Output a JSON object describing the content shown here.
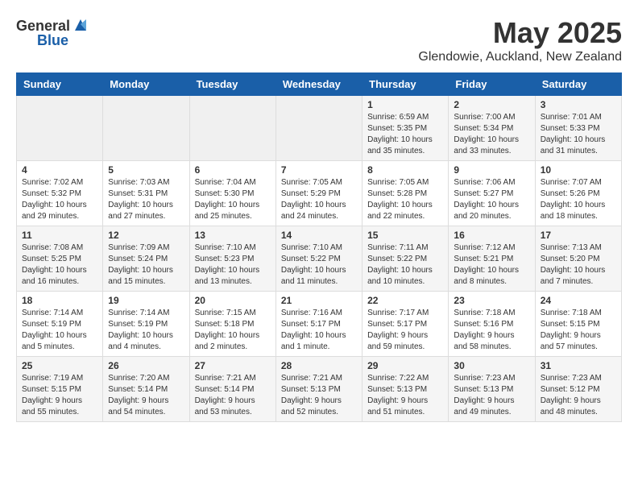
{
  "header": {
    "logo": {
      "general": "General",
      "blue": "Blue"
    },
    "title": "May 2025",
    "location": "Glendowie, Auckland, New Zealand"
  },
  "weekdays": [
    "Sunday",
    "Monday",
    "Tuesday",
    "Wednesday",
    "Thursday",
    "Friday",
    "Saturday"
  ],
  "weeks": [
    [
      {
        "day": "",
        "info": ""
      },
      {
        "day": "",
        "info": ""
      },
      {
        "day": "",
        "info": ""
      },
      {
        "day": "",
        "info": ""
      },
      {
        "day": "1",
        "info": "Sunrise: 6:59 AM\nSunset: 5:35 PM\nDaylight: 10 hours\nand 35 minutes."
      },
      {
        "day": "2",
        "info": "Sunrise: 7:00 AM\nSunset: 5:34 PM\nDaylight: 10 hours\nand 33 minutes."
      },
      {
        "day": "3",
        "info": "Sunrise: 7:01 AM\nSunset: 5:33 PM\nDaylight: 10 hours\nand 31 minutes."
      }
    ],
    [
      {
        "day": "4",
        "info": "Sunrise: 7:02 AM\nSunset: 5:32 PM\nDaylight: 10 hours\nand 29 minutes."
      },
      {
        "day": "5",
        "info": "Sunrise: 7:03 AM\nSunset: 5:31 PM\nDaylight: 10 hours\nand 27 minutes."
      },
      {
        "day": "6",
        "info": "Sunrise: 7:04 AM\nSunset: 5:30 PM\nDaylight: 10 hours\nand 25 minutes."
      },
      {
        "day": "7",
        "info": "Sunrise: 7:05 AM\nSunset: 5:29 PM\nDaylight: 10 hours\nand 24 minutes."
      },
      {
        "day": "8",
        "info": "Sunrise: 7:05 AM\nSunset: 5:28 PM\nDaylight: 10 hours\nand 22 minutes."
      },
      {
        "day": "9",
        "info": "Sunrise: 7:06 AM\nSunset: 5:27 PM\nDaylight: 10 hours\nand 20 minutes."
      },
      {
        "day": "10",
        "info": "Sunrise: 7:07 AM\nSunset: 5:26 PM\nDaylight: 10 hours\nand 18 minutes."
      }
    ],
    [
      {
        "day": "11",
        "info": "Sunrise: 7:08 AM\nSunset: 5:25 PM\nDaylight: 10 hours\nand 16 minutes."
      },
      {
        "day": "12",
        "info": "Sunrise: 7:09 AM\nSunset: 5:24 PM\nDaylight: 10 hours\nand 15 minutes."
      },
      {
        "day": "13",
        "info": "Sunrise: 7:10 AM\nSunset: 5:23 PM\nDaylight: 10 hours\nand 13 minutes."
      },
      {
        "day": "14",
        "info": "Sunrise: 7:10 AM\nSunset: 5:22 PM\nDaylight: 10 hours\nand 11 minutes."
      },
      {
        "day": "15",
        "info": "Sunrise: 7:11 AM\nSunset: 5:22 PM\nDaylight: 10 hours\nand 10 minutes."
      },
      {
        "day": "16",
        "info": "Sunrise: 7:12 AM\nSunset: 5:21 PM\nDaylight: 10 hours\nand 8 minutes."
      },
      {
        "day": "17",
        "info": "Sunrise: 7:13 AM\nSunset: 5:20 PM\nDaylight: 10 hours\nand 7 minutes."
      }
    ],
    [
      {
        "day": "18",
        "info": "Sunrise: 7:14 AM\nSunset: 5:19 PM\nDaylight: 10 hours\nand 5 minutes."
      },
      {
        "day": "19",
        "info": "Sunrise: 7:14 AM\nSunset: 5:19 PM\nDaylight: 10 hours\nand 4 minutes."
      },
      {
        "day": "20",
        "info": "Sunrise: 7:15 AM\nSunset: 5:18 PM\nDaylight: 10 hours\nand 2 minutes."
      },
      {
        "day": "21",
        "info": "Sunrise: 7:16 AM\nSunset: 5:17 PM\nDaylight: 10 hours\nand 1 minute."
      },
      {
        "day": "22",
        "info": "Sunrise: 7:17 AM\nSunset: 5:17 PM\nDaylight: 9 hours\nand 59 minutes."
      },
      {
        "day": "23",
        "info": "Sunrise: 7:18 AM\nSunset: 5:16 PM\nDaylight: 9 hours\nand 58 minutes."
      },
      {
        "day": "24",
        "info": "Sunrise: 7:18 AM\nSunset: 5:15 PM\nDaylight: 9 hours\nand 57 minutes."
      }
    ],
    [
      {
        "day": "25",
        "info": "Sunrise: 7:19 AM\nSunset: 5:15 PM\nDaylight: 9 hours\nand 55 minutes."
      },
      {
        "day": "26",
        "info": "Sunrise: 7:20 AM\nSunset: 5:14 PM\nDaylight: 9 hours\nand 54 minutes."
      },
      {
        "day": "27",
        "info": "Sunrise: 7:21 AM\nSunset: 5:14 PM\nDaylight: 9 hours\nand 53 minutes."
      },
      {
        "day": "28",
        "info": "Sunrise: 7:21 AM\nSunset: 5:13 PM\nDaylight: 9 hours\nand 52 minutes."
      },
      {
        "day": "29",
        "info": "Sunrise: 7:22 AM\nSunset: 5:13 PM\nDaylight: 9 hours\nand 51 minutes."
      },
      {
        "day": "30",
        "info": "Sunrise: 7:23 AM\nSunset: 5:13 PM\nDaylight: 9 hours\nand 49 minutes."
      },
      {
        "day": "31",
        "info": "Sunrise: 7:23 AM\nSunset: 5:12 PM\nDaylight: 9 hours\nand 48 minutes."
      }
    ]
  ]
}
